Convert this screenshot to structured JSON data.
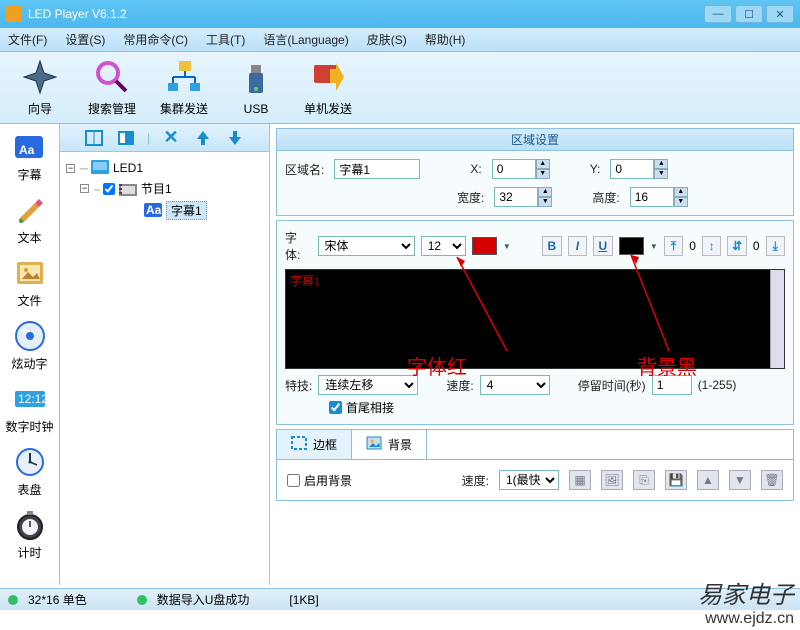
{
  "title": "LED Player V6.1.2",
  "menu": [
    "文件(F)",
    "设置(S)",
    "常用命令(C)",
    "工具(T)",
    "语言(Language)",
    "皮肤(S)",
    "帮助(H)"
  ],
  "toolbar": [
    {
      "label": "向导",
      "icon": "compass"
    },
    {
      "label": "搜索管理",
      "icon": "search"
    },
    {
      "label": "集群发送",
      "icon": "network"
    },
    {
      "label": "USB",
      "icon": "usb"
    },
    {
      "label": "单机发送",
      "icon": "send"
    }
  ],
  "leftbar": [
    {
      "label": "字幕",
      "icon": "aa-blue"
    },
    {
      "label": "文本",
      "icon": "pencil"
    },
    {
      "label": "文件",
      "icon": "picture"
    },
    {
      "label": "炫动字",
      "icon": "disc"
    },
    {
      "label": "数字时钟",
      "icon": "clock-digital"
    },
    {
      "label": "表盘",
      "icon": "clock-analog"
    },
    {
      "label": "计时",
      "icon": "stopwatch"
    }
  ],
  "tree": {
    "root": "LED1",
    "program": "节目1",
    "subtitle": "字幕1"
  },
  "region_panel": {
    "title": "区域设置",
    "name_label": "区域名:",
    "name_value": "字幕1",
    "x_label": "X:",
    "x_value": "0",
    "y_label": "Y:",
    "y_value": "0",
    "w_label": "宽度:",
    "w_value": "32",
    "h_label": "高度:",
    "h_value": "16"
  },
  "font_row": {
    "font_label": "字体:",
    "font_name": "宋体",
    "font_size": "12",
    "font_color": "#d40000",
    "bg_color": "#000000",
    "align_spacing": "0"
  },
  "preview_text": "字幕1",
  "annotations": {
    "font": "字体红",
    "bg": "背景黑"
  },
  "effect": {
    "label": "特技:",
    "value": "连续左移",
    "speed_label": "速度:",
    "speed_value": "4",
    "stay_label": "停留时间(秒)",
    "stay_value": "1",
    "stay_range": "(1-255)",
    "loop_label": "首尾相接"
  },
  "tabs": {
    "border": "边框",
    "bg": "背景"
  },
  "bg_panel": {
    "enable_label": "启用背景",
    "speed_label": "速度:",
    "speed_value": "1(最快"
  },
  "status": {
    "res": "32*16 单色",
    "import": "数据导入U盘成功",
    "size": "[1KB]"
  },
  "watermark": {
    "line1": "易家电子",
    "line2": "www.ejdz.cn"
  }
}
